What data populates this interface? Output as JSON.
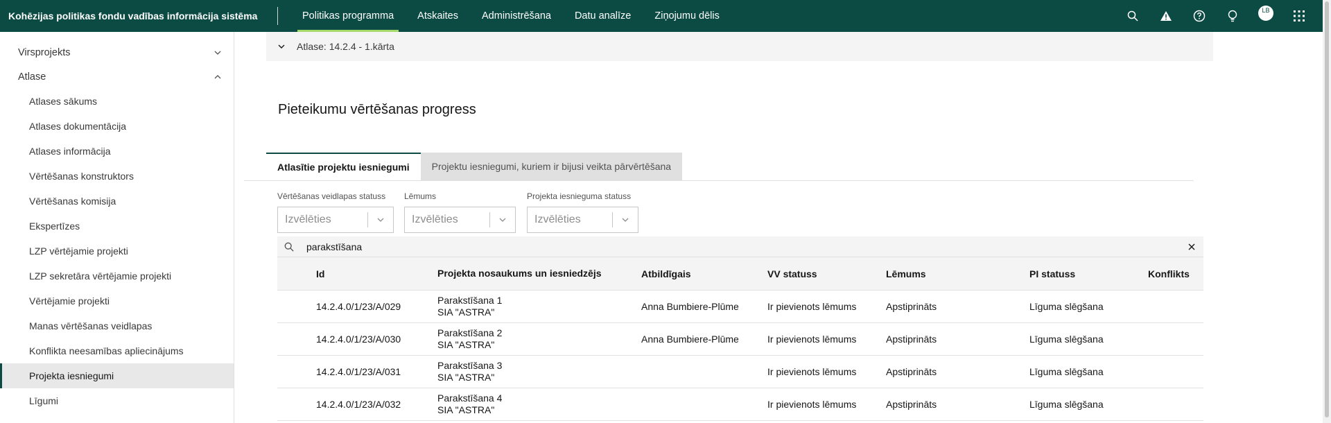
{
  "header": {
    "app_title": "Kohēzijas politikas fondu vadības informācija sistēma",
    "nav": [
      {
        "label": "Politikas programma",
        "active": true
      },
      {
        "label": "Atskaites",
        "active": false
      },
      {
        "label": "Administrēšana",
        "active": false
      },
      {
        "label": "Datu analīze",
        "active": false
      },
      {
        "label": "Ziņojumu dēlis",
        "active": false
      }
    ],
    "icons": [
      "search-icon",
      "warning-icon",
      "help-icon",
      "idea-icon",
      "avatar",
      "app-switcher-icon"
    ],
    "avatar_initials": "LB",
    "accent": "#0b4b43"
  },
  "sidebar": {
    "groups": [
      {
        "label": "Virsprojekts",
        "expanded": false
      },
      {
        "label": "Atlase",
        "expanded": true
      }
    ],
    "items": [
      {
        "label": "Atlases sākums"
      },
      {
        "label": "Atlases dokumentācija"
      },
      {
        "label": "Atlases informācija"
      },
      {
        "label": "Vērtēšanas konstruktors"
      },
      {
        "label": "Vērtēšanas komisija"
      },
      {
        "label": "Ekspertīzes"
      },
      {
        "label": "LZP vērtējamie projekti"
      },
      {
        "label": "LZP sekretāra vērtējamie projekti"
      },
      {
        "label": "Vērtējamie projekti"
      },
      {
        "label": "Manas vērtēšanas veidlapas"
      },
      {
        "label": "Konflikta neesamības apliecinājums"
      },
      {
        "label": "Projekta iesniegumi",
        "active": true
      },
      {
        "label": "Līgumi"
      }
    ]
  },
  "main": {
    "accordion_label": "Atlase: 14.2.4 - 1.kārta",
    "page_title": "Pieteikumu vērtēšanas progress",
    "tabs": [
      {
        "label": "Atlasītie projektu iesniegumi",
        "active": true
      },
      {
        "label": "Projektu iesniegumi, kuriem ir bijusi veikta pārvērtēšana",
        "active": false
      }
    ],
    "filters": [
      {
        "label": "Vērtēšanas veidlapas statuss",
        "placeholder": "Izvēlēties"
      },
      {
        "label": "Lēmums",
        "placeholder": "Izvēlēties"
      },
      {
        "label": "Projekta iesnieguma statuss",
        "placeholder": "Izvēlēties"
      }
    ],
    "search_value": "parakstīšana",
    "table": {
      "columns": [
        "Id",
        "Projekta nosaukums un iesniedzējs",
        "Atbildīgais",
        "VV statuss",
        "Lēmums",
        "PI statuss",
        "Konflikts"
      ],
      "rows": [
        {
          "id": "14.2.4.0/1/23/A/029",
          "name": "Parakstīšana 1",
          "applicant": "SIA \"ASTRA\"",
          "responsible": "Anna Bumbiere-Plūme",
          "vv_status": "Ir pievienots lēmums",
          "decision": "Apstiprināts",
          "pi_status": "Līguma slēgšana",
          "conflict": ""
        },
        {
          "id": "14.2.4.0/1/23/A/030",
          "name": "Parakstīšana 2",
          "applicant": "SIA \"ASTRA\"",
          "responsible": "Anna Bumbiere-Plūme",
          "vv_status": "Ir pievienots lēmums",
          "decision": "Apstiprināts",
          "pi_status": "Līguma slēgšana",
          "conflict": ""
        },
        {
          "id": "14.2.4.0/1/23/A/031",
          "name": "Parakstīšana 3",
          "applicant": "SIA \"ASTRA\"",
          "responsible": "",
          "vv_status": "Ir pievienots lēmums",
          "decision": "Apstiprināts",
          "pi_status": "Līguma slēgšana",
          "conflict": ""
        },
        {
          "id": "14.2.4.0/1/23/A/032",
          "name": "Parakstīšana 4",
          "applicant": "SIA \"ASTRA\"",
          "responsible": "",
          "vv_status": "Ir pievienots lēmums",
          "decision": "Apstiprināts",
          "pi_status": "Līguma slēgšana",
          "conflict": ""
        }
      ]
    }
  }
}
